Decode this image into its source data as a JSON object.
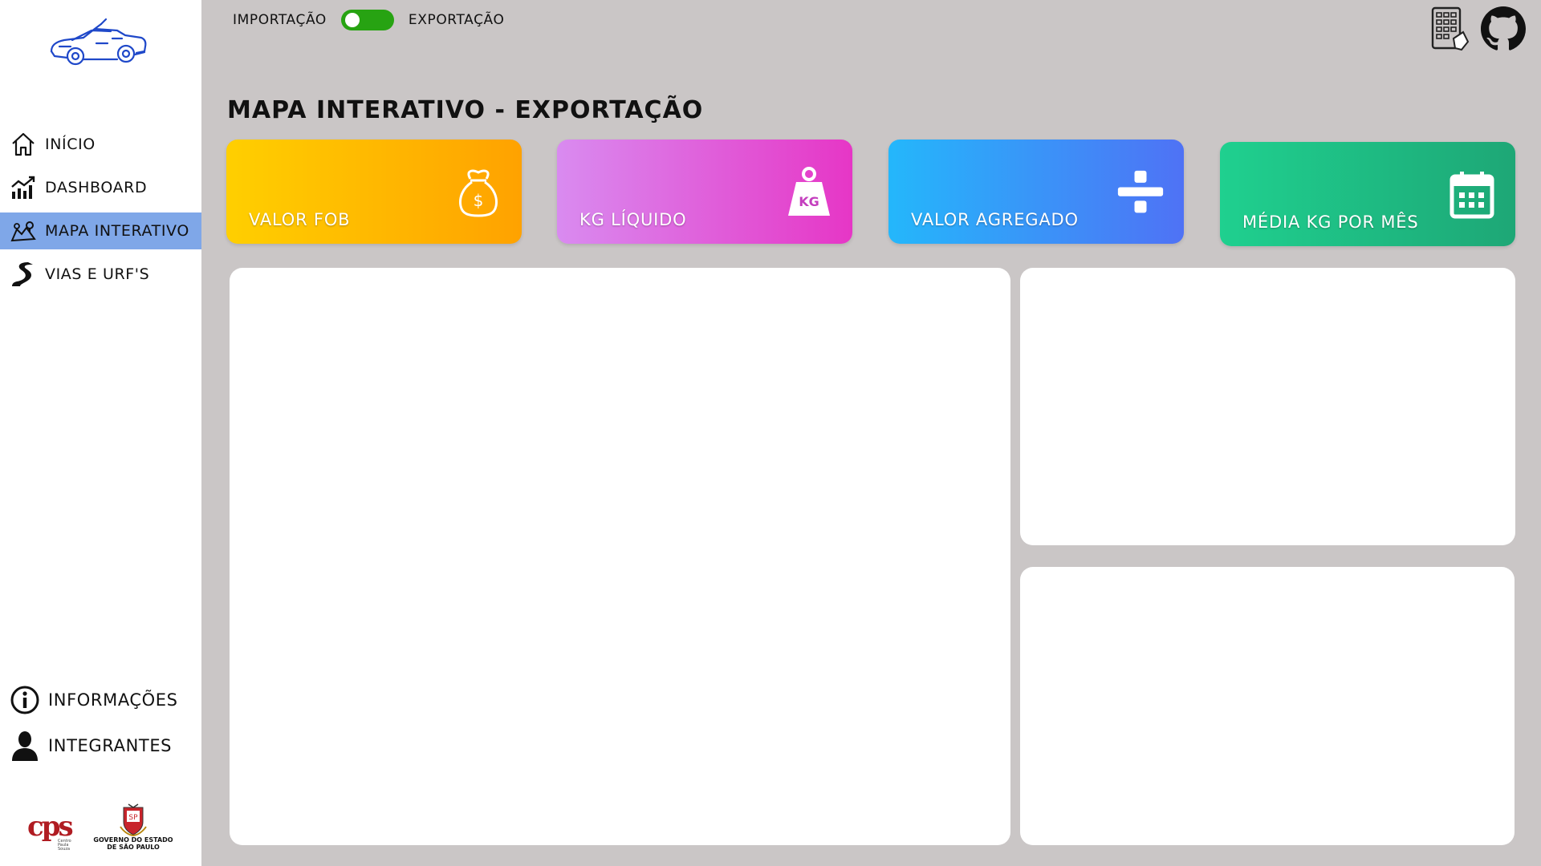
{
  "sidebar": {
    "logo_icon": "car-logo-icon",
    "items": [
      {
        "label": "Início",
        "icon": "home-icon",
        "active": false
      },
      {
        "label": "Dashboard",
        "icon": "dashboard-chart-icon",
        "active": false
      },
      {
        "label": "Mapa Interativo",
        "icon": "map-icon",
        "active": true
      },
      {
        "label": "Vias e URF's",
        "icon": "road-icon",
        "active": false
      }
    ],
    "bottom_items": [
      {
        "label": "Informações",
        "icon": "info-icon"
      },
      {
        "label": "Integrantes",
        "icon": "user-icon"
      }
    ],
    "footer": {
      "cps_text": "cps",
      "cps_sub": "Centro Paula Souza",
      "gov_text_1": "GOVERNO DO ESTADO",
      "gov_text_2": "DE SÃO PAULO"
    }
  },
  "header": {
    "toggle_left_label": "Importação",
    "toggle_right_label": "Exportação",
    "toggle_state": "Exportação",
    "icons": [
      "spreadsheet-icon",
      "github-icon"
    ]
  },
  "main": {
    "title": "Mapa Interativo - Exportação",
    "cards": [
      {
        "label": "Valor FOB",
        "icon": "money-bag-icon",
        "icon_text": "$"
      },
      {
        "label": "KG Líquido",
        "icon": "weight-icon",
        "icon_text": "KG"
      },
      {
        "label": "Valor Agregado",
        "icon": "divide-icon"
      },
      {
        "label": "Média KG por Mês",
        "icon": "calendar-icon"
      }
    ]
  },
  "colors": {
    "background": "#cac6c6",
    "active_nav": "#7fa7e8",
    "toggle_on": "#27a312",
    "card_fob": "#ffb800",
    "card_kg": "#e060d8",
    "card_valor": "#3a94f8",
    "card_media": "#1fbd83"
  }
}
